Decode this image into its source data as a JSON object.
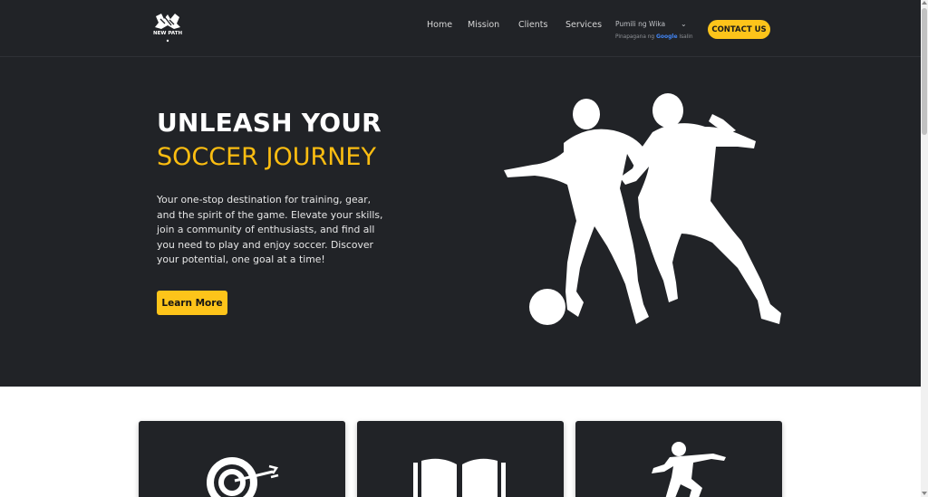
{
  "brand": {
    "logo_text": "NEW PATH",
    "icon": "newpath-logo-icon"
  },
  "nav": {
    "links": [
      {
        "label": "Home"
      },
      {
        "label": "Mission"
      },
      {
        "label": "Clients"
      },
      {
        "label": "Services"
      }
    ],
    "language": {
      "label": "Pumili ng Wika",
      "powered_prefix": "Pinapagana ng",
      "powered_google": "Google",
      "powered_suffix": "Isalin"
    },
    "contact_label": "CONTACT US"
  },
  "hero": {
    "title_line1": "UNLEASH YOUR",
    "title_line2": "SOCCER JOURNEY",
    "description": "Your one-stop destination for training, gear, and the spirit of the game. Elevate your skills, join a community of enthusiasts, and find all you need to play and enjoy soccer. Discover your potential, one goal at a time!",
    "cta_label": "Learn More",
    "image_icon": "soccer-players-silhouette-icon"
  },
  "cards": [
    {
      "icon": "target-arrow-icon"
    },
    {
      "icon": "open-book-icon"
    },
    {
      "icon": "kicking-player-icon"
    }
  ],
  "colors": {
    "background_dark": "#212327",
    "accent": "#fdc41a",
    "title_accent": "#fbbd11",
    "page_bg": "#ffffff"
  }
}
